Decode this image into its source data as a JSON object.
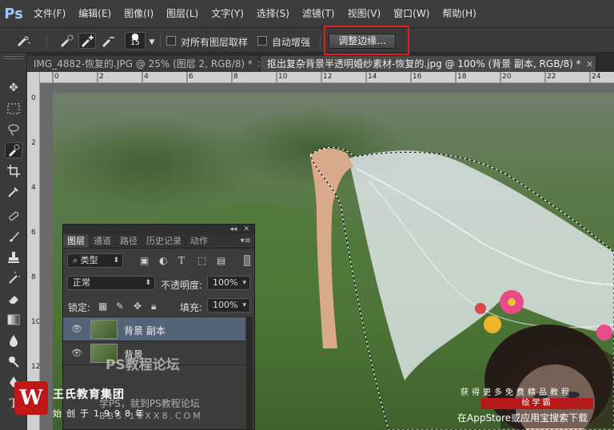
{
  "app": {
    "logo": "Ps"
  },
  "menu": [
    "文件(F)",
    "编辑(E)",
    "图像(I)",
    "图层(L)",
    "文字(Y)",
    "选择(S)",
    "滤镜(T)",
    "视图(V)",
    "窗口(W)",
    "帮助(H)"
  ],
  "options": {
    "brush_size": "15",
    "sample_all_layers_label": "对所有图层取样",
    "auto_enhance_label": "自动增强",
    "refine_edge_label": "调整边缘..."
  },
  "tabs": [
    {
      "label": "IMG_4882-恢复的.JPG @ 25% (图层 2, RGB/8) *",
      "active": false
    },
    {
      "label": "抠出复杂背景半透明婚纱素材-恢复的.jpg @ 100% (背景 副本, RGB/8) *",
      "active": true
    }
  ],
  "ruler": {
    "top_labels": [
      "0",
      "2",
      "4",
      "6",
      "8",
      "10",
      "12",
      "14",
      "16",
      "18",
      "20",
      "22",
      "24"
    ],
    "left_labels": [
      "0",
      "2",
      "4",
      "6",
      "8",
      "10",
      "12",
      "14"
    ]
  },
  "layers_panel": {
    "tabs": [
      "图层",
      "通道",
      "路径",
      "历史记录",
      "动作"
    ],
    "filter_kind": "类型",
    "blend_mode": "正常",
    "opacity_label": "不透明度:",
    "opacity_value": "100%",
    "lock_label": "锁定:",
    "fill_label": "填充:",
    "fill_value": "100%",
    "layers": [
      {
        "name": "背景 副本",
        "selected": true
      },
      {
        "name": "背景",
        "selected": false
      }
    ]
  },
  "watermarks": {
    "logo_letter": "W",
    "company": "王氏教育集团",
    "slogan": "始创于1998年",
    "forum": "PS教程论坛",
    "forum_sub": "学PS，就到PS教程论坛",
    "url": "BBS.16XX8.COM",
    "right_top": "获得更多免费精品教程",
    "right_badge": "绘学霸",
    "right_bottom": "在AppStore或应用宝搜索下载"
  },
  "colors": {
    "highlight": "#e01e1e",
    "selected_layer": "#546478",
    "panel_bg": "#3c3c3c"
  }
}
